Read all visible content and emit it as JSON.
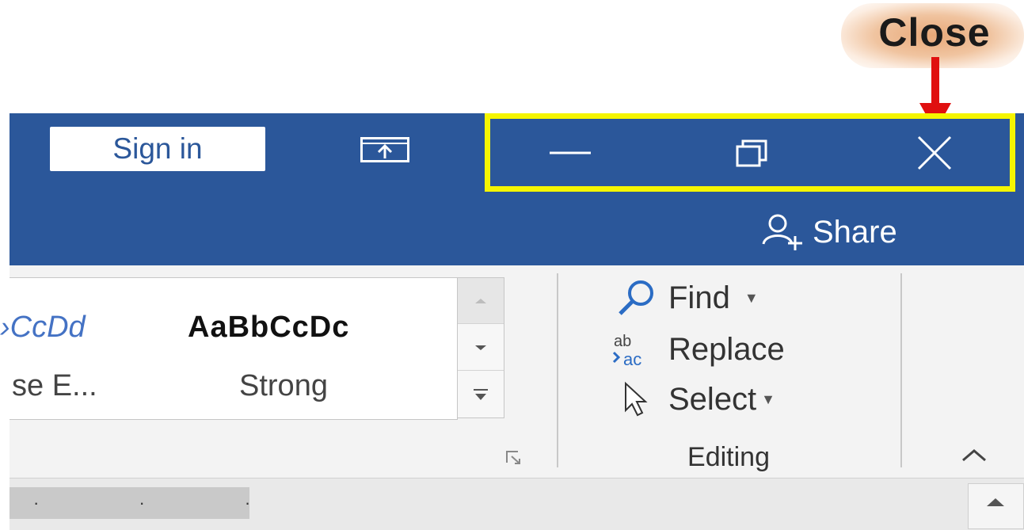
{
  "annotation": {
    "label": "Close"
  },
  "titlebar": {
    "sign_in": "Sign in",
    "share": "Share"
  },
  "styles_gallery": {
    "items": [
      {
        "preview": "›CcDd",
        "name": "se E..."
      },
      {
        "preview": "AaBbCcDc",
        "name": "Strong"
      }
    ]
  },
  "editing": {
    "find": "Find",
    "replace": "Replace",
    "select": "Select",
    "group_label": "Editing"
  },
  "ruler": {
    "dots": "· · ·"
  },
  "colors": {
    "accent": "#2b579a",
    "highlight": "#f5f500",
    "arrow": "#e01010"
  }
}
